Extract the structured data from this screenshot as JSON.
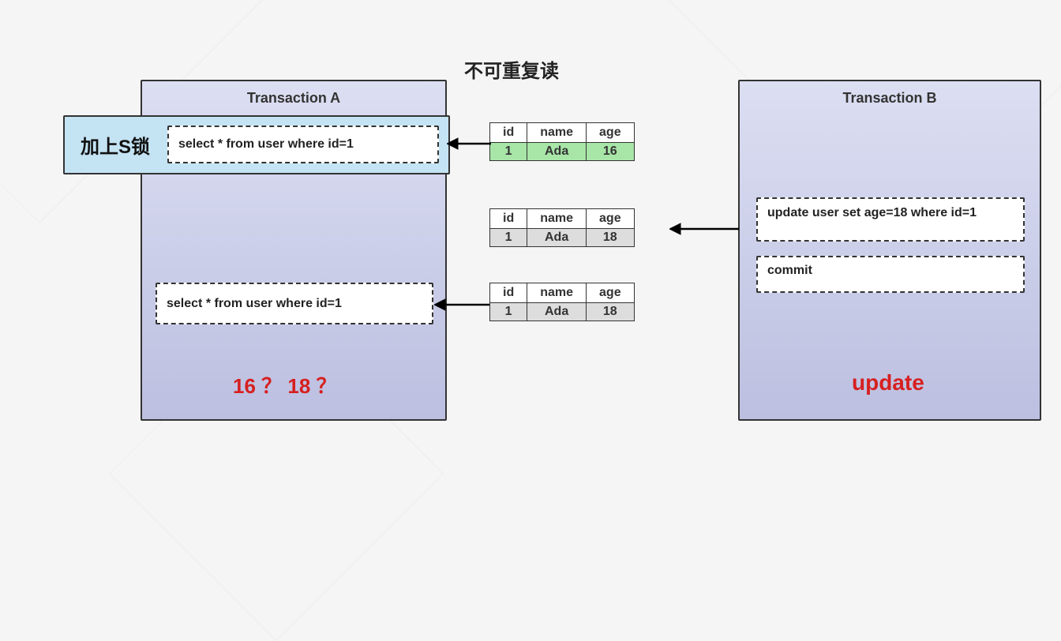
{
  "title": "不可重复读",
  "panelA": {
    "title": "Transaction A"
  },
  "panelB": {
    "title": "Transaction B"
  },
  "lock": {
    "label": "加上S锁"
  },
  "sql": {
    "select1": "select * from user where id=1",
    "select2": "select * from user where id=1",
    "update": "update user set age=18 where id=1",
    "commit": "commit"
  },
  "tables": {
    "headers": {
      "id": "id",
      "name": "name",
      "age": "age"
    },
    "row1": {
      "id": "1",
      "name": "Ada",
      "age": "16"
    },
    "row2": {
      "id": "1",
      "name": "Ada",
      "age": "18"
    },
    "row3": {
      "id": "1",
      "name": "Ada",
      "age": "18"
    }
  },
  "question": {
    "a": "16 ？ 18 ？",
    "b": "update"
  }
}
